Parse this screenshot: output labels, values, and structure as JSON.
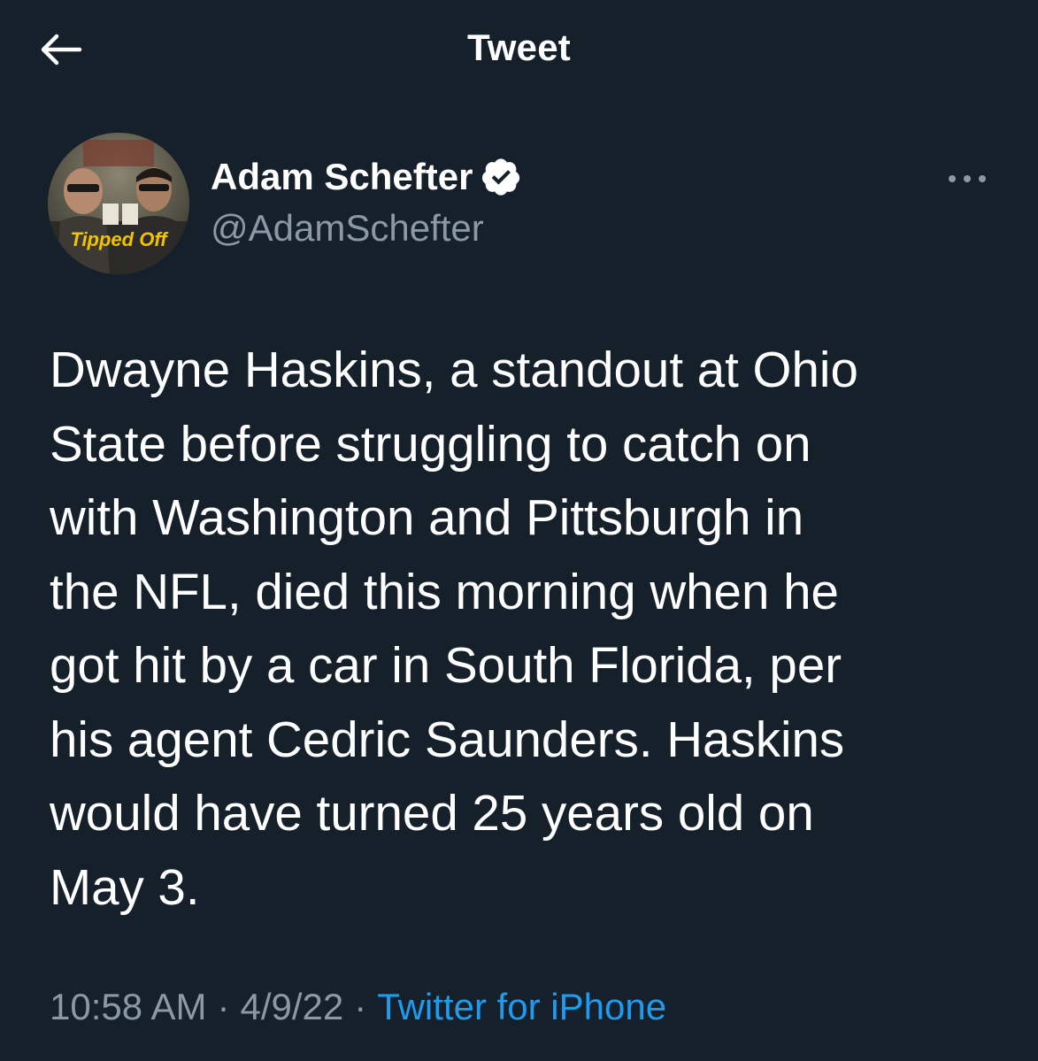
{
  "header": {
    "title": "Tweet",
    "back_icon": "arrow-left-icon"
  },
  "author": {
    "display_name": "Adam Schefter",
    "handle": "@AdamSchefter",
    "verified_icon": "verified-badge-icon",
    "avatar_caption": "Tipped Off"
  },
  "tweet": {
    "text": "Dwayne Haskins, a standout at Ohio\nState before struggling to catch on\nwith Washington and Pittsburgh in\nthe NFL, died this morning when he\ngot hit by a car in South Florida, per\nhis agent Cedric Saunders. Haskins\nwould have turned 25 years old on\nMay 3.",
    "time": "10:58 AM",
    "separator": "·",
    "date": "4/9/22",
    "source": "Twitter for iPhone"
  },
  "more_icon": "more-horizontal-icon",
  "colors": {
    "background": "#15202b",
    "text": "#ffffff",
    "secondary": "#8b98a5",
    "link": "#1d9bf0"
  }
}
